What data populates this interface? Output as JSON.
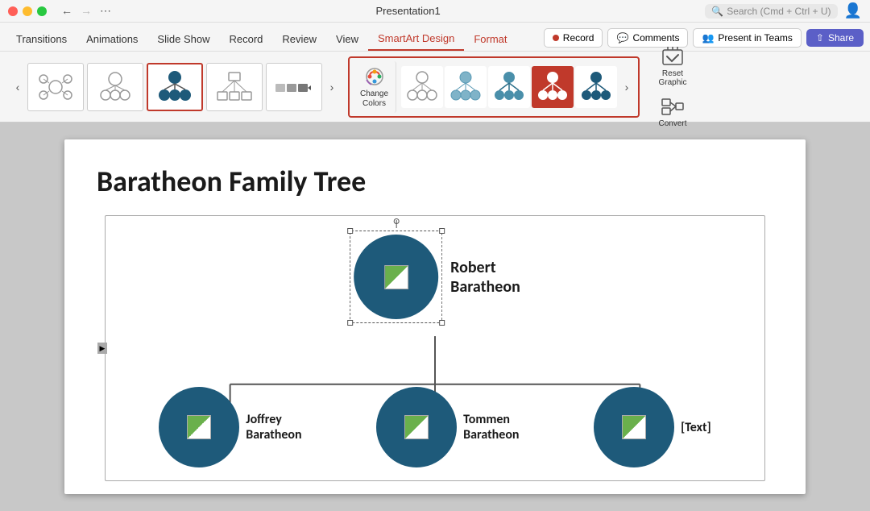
{
  "titlebar": {
    "title": "Presentation1",
    "search_placeholder": "Search (Cmd + Ctrl + U)"
  },
  "tabs": {
    "items": [
      {
        "label": "Transitions",
        "active": false
      },
      {
        "label": "Animations",
        "active": false
      },
      {
        "label": "Slide Show",
        "active": false
      },
      {
        "label": "Record",
        "active": false
      },
      {
        "label": "Review",
        "active": false
      },
      {
        "label": "View",
        "active": false
      },
      {
        "label": "SmartArt Design",
        "active": true,
        "color": "red"
      },
      {
        "label": "Format",
        "active": false,
        "color": "red"
      }
    ]
  },
  "toolbar_right": {
    "record_label": "Record",
    "comments_label": "Comments",
    "present_label": "Present in Teams",
    "share_label": "Share"
  },
  "toolbar": {
    "change_colors_label": "Change\nColors",
    "reset_label": "Reset\nGraphic",
    "convert_label": "Convert"
  },
  "slide": {
    "title": "Baratheon Family Tree",
    "root_node": "Robert\nBaratheon",
    "child1": "Joffrey\nBaratheon",
    "child2": "Tommen\nBaratheon",
    "child3": "[Text]"
  }
}
